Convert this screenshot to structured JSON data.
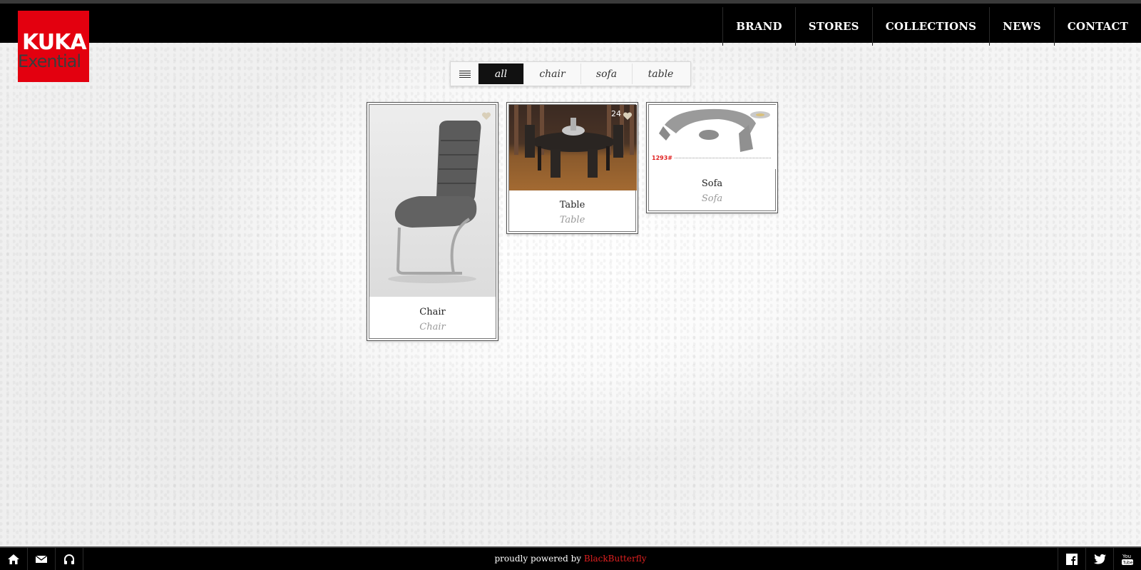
{
  "brand": {
    "line1": "KUKA",
    "line2": "Exential",
    "color": "#e3000f"
  },
  "nav": {
    "items": [
      "BRAND",
      "STORES",
      "COLLECTIONS",
      "NEWS",
      "CONTACT"
    ]
  },
  "filters": {
    "items": [
      "all",
      "chair",
      "sofa",
      "table"
    ],
    "active": "all"
  },
  "cards": [
    {
      "title": "Chair",
      "category": "Chair"
    },
    {
      "title": "Table",
      "category": "Table",
      "likes": "24"
    },
    {
      "title": "Sofa",
      "category": "Sofa",
      "label": "1293#"
    }
  ],
  "footer": {
    "powered_prefix": "proudly powered by",
    "powered_brand": "BlackButterfly",
    "accent": "#e02020",
    "left_icons": [
      "home-icon",
      "mail-icon",
      "headphones-icon"
    ],
    "right_icons": [
      "facebook-icon",
      "twitter-icon",
      "youtube-icon"
    ]
  }
}
